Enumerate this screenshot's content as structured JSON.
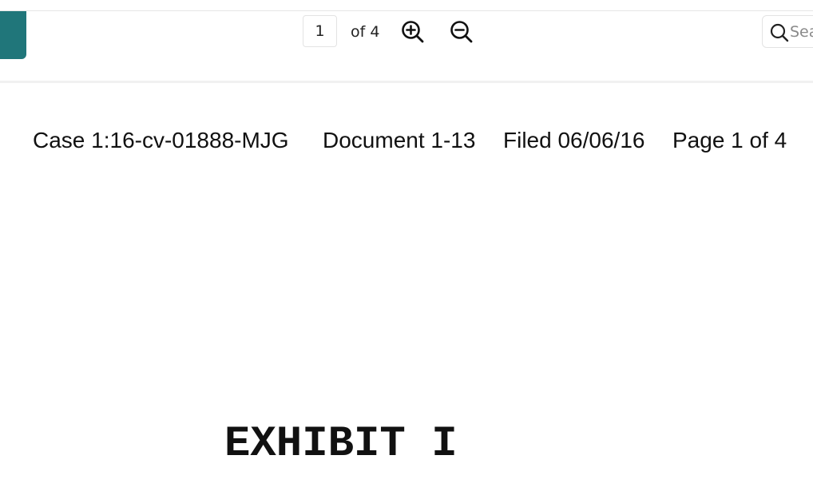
{
  "viewer": {
    "current_page": "1",
    "page_total_label": "of 4",
    "search_placeholder": "Search"
  },
  "colors": {
    "side_tab": "#20767a"
  },
  "icons": {
    "zoom_in": "zoom-in-icon",
    "zoom_out": "zoom-out-icon",
    "search": "search-icon"
  },
  "document": {
    "header": {
      "case": "Case 1:16-cv-01888-MJG",
      "document": "Document 1-13",
      "filed": "Filed 06/06/16",
      "page": "Page 1 of 4"
    },
    "title": "EXHIBIT I"
  }
}
